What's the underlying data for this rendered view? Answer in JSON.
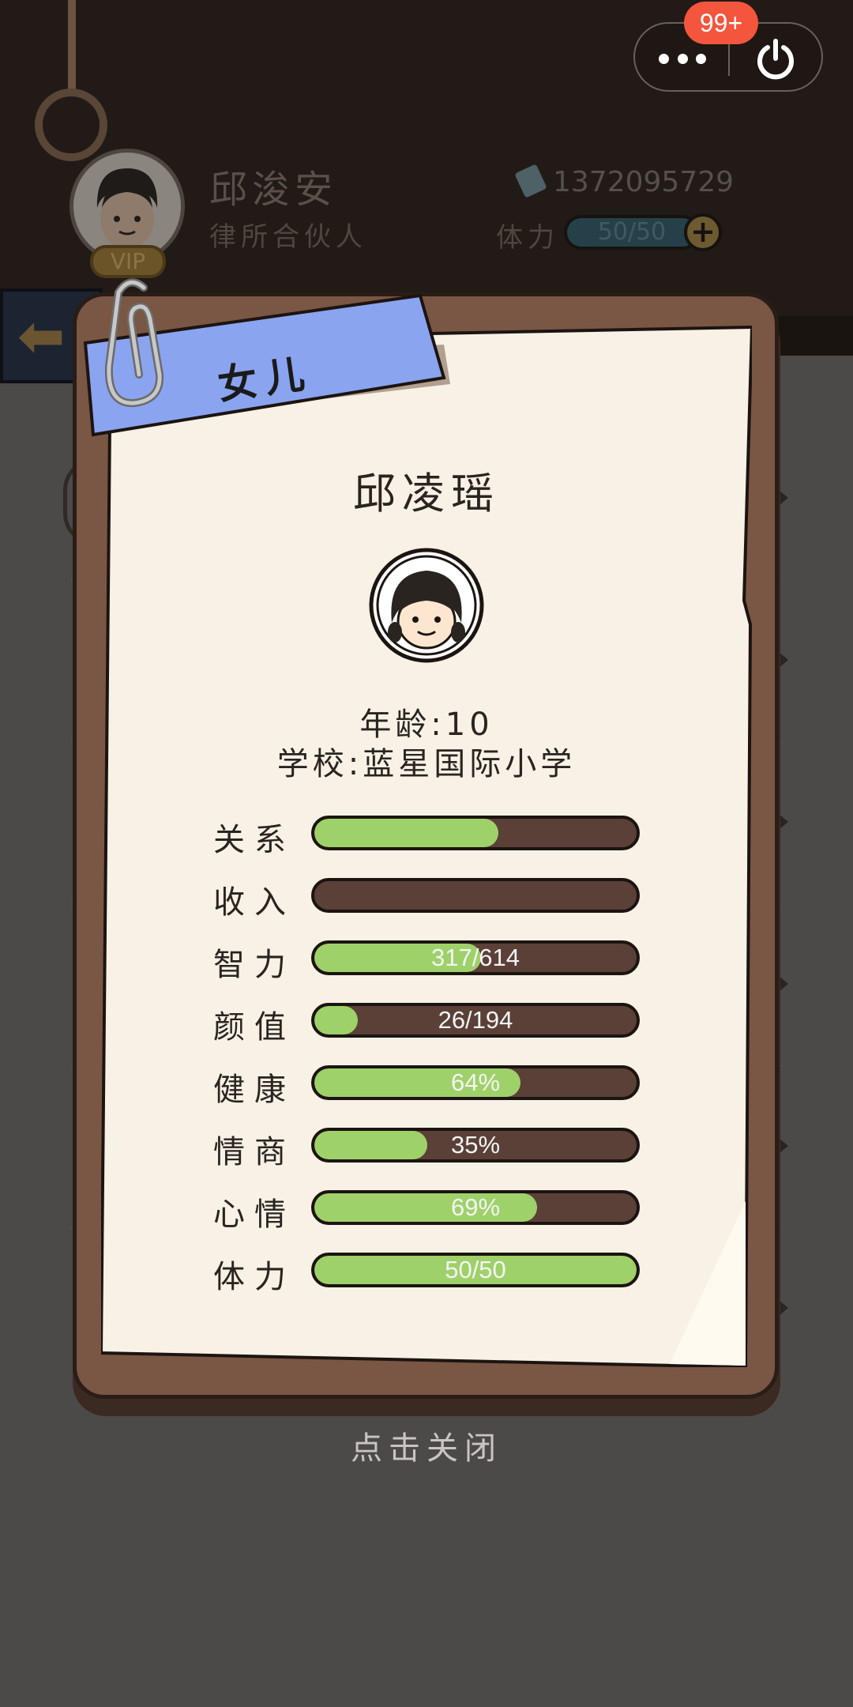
{
  "header": {
    "player_name": "邱浚安",
    "player_title": "律所合伙人",
    "vip_label": "VIP",
    "money": "1372095729",
    "stamina_label": "体力",
    "stamina_value": "50/50",
    "plus_symbol": "+"
  },
  "capsule": {
    "badge": "99+"
  },
  "modal": {
    "tab_label": "女儿",
    "child_name": "邱凌瑶",
    "age_text": "年龄:10",
    "school_text": "学校:蓝星国际小学",
    "stats": [
      {
        "label": "关系",
        "fill": 0.57,
        "text": ""
      },
      {
        "label": "收入",
        "fill": 0.0,
        "text": ""
      },
      {
        "label": "智力",
        "fill": 0.516,
        "text": "317/614"
      },
      {
        "label": "颜值",
        "fill": 0.134,
        "text": "26/194"
      },
      {
        "label": "健康",
        "fill": 0.64,
        "text": "64%"
      },
      {
        "label": "情商",
        "fill": 0.35,
        "text": "35%"
      },
      {
        "label": "心情",
        "fill": 0.69,
        "text": "69%"
      },
      {
        "label": "体力",
        "fill": 1.0,
        "text": "50/50"
      }
    ],
    "close_hint": "点击关闭"
  },
  "colors": {
    "bar_fill": "#9fd16a",
    "bar_track": "#5a4037",
    "tab_blue": "#8aa4f0",
    "badge_red": "#f3553d"
  }
}
